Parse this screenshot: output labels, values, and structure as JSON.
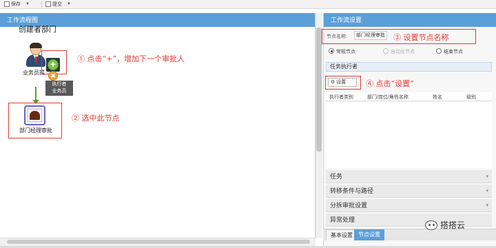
{
  "toolbar": {
    "save_label": "保存",
    "submit_label": "提交"
  },
  "left_panel": {
    "title": "工作流程图",
    "creator": "创建者部门",
    "user_node_label": "业务员提",
    "add_symbol": "+",
    "executor_tooltip_line1": "执行者",
    "executor_tooltip_line2": "业务员",
    "selected_node_label": "部门经理审批"
  },
  "annotations": {
    "a1": "① 点击“+”，增加下一个审批人",
    "a2": "② 选中此节点",
    "a3": "③ 设置节点名称",
    "a4": "④ 点击“设置”"
  },
  "right_panel": {
    "title": "工作流设置",
    "node_name_label": "节点名称:",
    "node_name_value": "部门经理审批",
    "radio_options": [
      {
        "label": "常规节点",
        "selected": true,
        "disabled": false
      },
      {
        "label": "自动化节点",
        "selected": false,
        "disabled": true
      },
      {
        "label": "结束节点",
        "selected": false,
        "disabled": false
      }
    ],
    "tasks_header": "任务执行者",
    "settings_button": "设置",
    "grid_columns": [
      "执行者类别",
      "部门/岗位/角色名称",
      "姓名",
      "级别"
    ],
    "accordion": [
      "任务",
      "转移条件与路径",
      "分拆审批设置",
      "异常处理"
    ],
    "tabs": [
      "基本设置",
      "节点设置"
    ],
    "active_tab": "节点设置"
  },
  "watermark": "搭搭云",
  "colors": {
    "header_blue": "#5a9fd8",
    "annotation_red": "#e53935",
    "add_green": "#7dc243",
    "node_purple": "#6b63c8"
  },
  "icons": [
    "save-icon",
    "submit-icon",
    "add-circle-icon",
    "executor-icon",
    "gear-icon",
    "wechat-icon",
    "person-icon",
    "node-icon"
  ]
}
